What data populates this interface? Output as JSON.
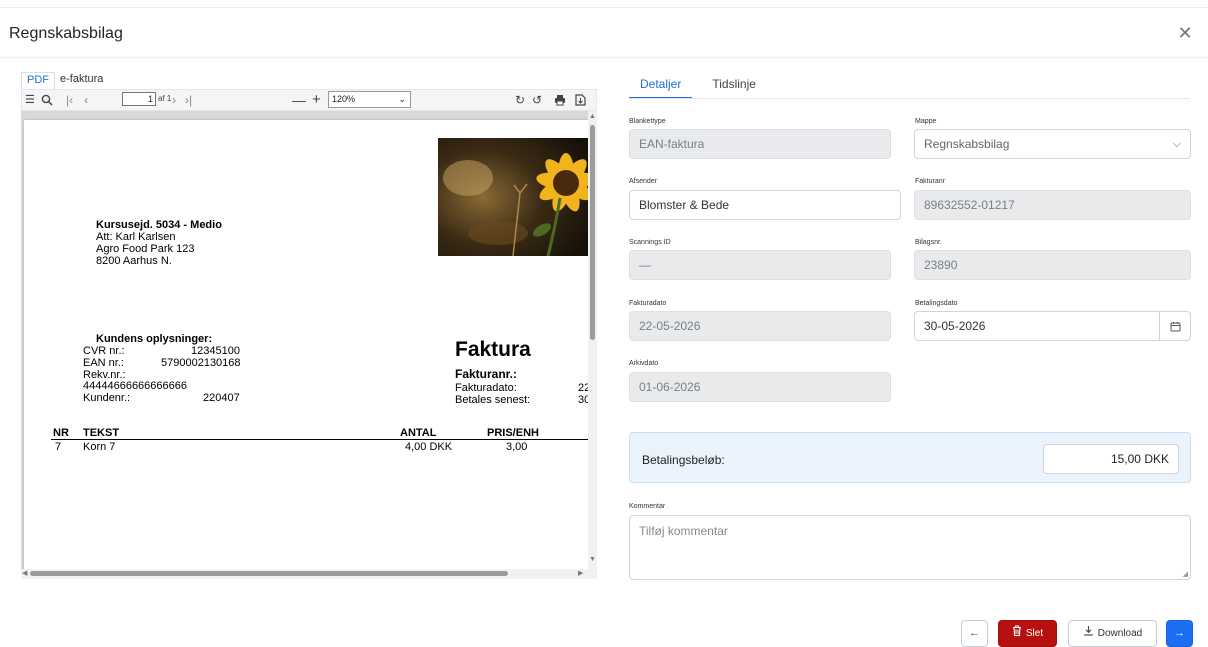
{
  "header": {
    "title": "Regnskabsbilag",
    "close_icon": "close-icon"
  },
  "viewer": {
    "tabs": [
      "PDF",
      "e-faktura"
    ],
    "active_tab": "PDF",
    "toolbar": {
      "page_value": "1",
      "page_of": "af 1",
      "zoom": "120%"
    },
    "document": {
      "company": "Kursusejd. 5034 - Medio",
      "address": [
        "Att: Karl Karlsen",
        "Agro Food Park 123",
        "8200  Aarhus N."
      ],
      "customer_heading": "Kundens oplysninger:",
      "cvr_label": "CVR nr.:",
      "cvr_value": "12345100",
      "ean_label": "EAN nr.:",
      "ean_value": "5790002130168",
      "rekv_label": "Rekv.nr.:",
      "rekv_value": "44444666666666666",
      "kunde_label": "Kundenr.:",
      "kunde_value": "220407",
      "faktura_title": "Faktura",
      "fakturanr_label": "Fakturanr.:",
      "fakturadato_label": "Fakturadato:",
      "fakturadato_value": "22",
      "betales_label": "Betales senest:",
      "betales_value": "30",
      "table_headers": [
        "NR",
        "TEKST",
        "ANTAL",
        "PRIS/ENH"
      ],
      "rows": [
        {
          "nr": "7",
          "tekst": "Korn 7",
          "antal": "4,00 DKK",
          "pris": "3,00"
        }
      ]
    }
  },
  "form": {
    "tabs": [
      "Detaljer",
      "Tidslinje"
    ],
    "active_tab": "Detaljer",
    "blankettype": {
      "label": "Blankettype",
      "value": "EAN-faktura"
    },
    "mappe": {
      "label": "Mappe",
      "value": "Regnskabsbilag"
    },
    "afsender": {
      "label": "Afsender",
      "value": "Blomster & Bede"
    },
    "fakturanr": {
      "label": "Fakturanr",
      "value": "89632552-01217"
    },
    "scanningsid": {
      "label": "Scannings ID",
      "value": "—"
    },
    "bilagsnr": {
      "label": "Bilagsnr.",
      "value": "23890"
    },
    "fakturadato": {
      "label": "Fakturadato",
      "value": "22-05-2026"
    },
    "betalingsdato": {
      "label": "Betalingsdato",
      "value": "30-05-2026"
    },
    "arkivdato": {
      "label": "Arkivdato",
      "value": "01-06-2026"
    },
    "betalingsbelob": {
      "label": "Betalingsbeløb:",
      "value": "15,00 DKK"
    },
    "kommentar": {
      "label": "Kommentar",
      "placeholder": "Tilføj kommentar"
    }
  },
  "footer": {
    "delete_label": "Slet",
    "download_label": "Download"
  },
  "colors": {
    "accent": "#1f6fd1",
    "danger": "#b7110f",
    "primary": "#1d6ff2",
    "highlight": "#eaf3fc"
  }
}
